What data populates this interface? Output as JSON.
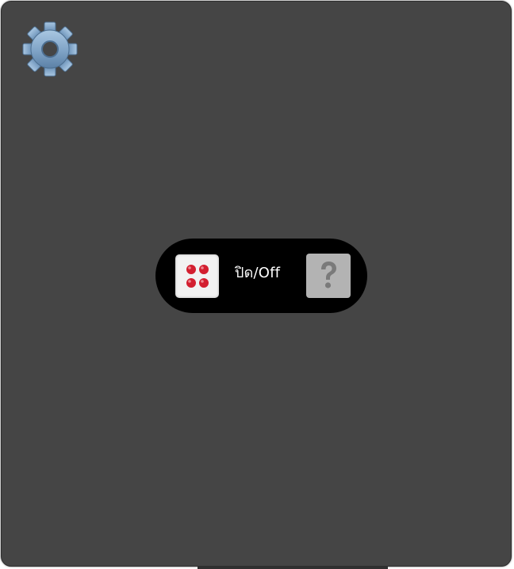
{
  "toolbar": {
    "settings_icon": "gear-icon",
    "dice_icon": "dice-four-icon",
    "mode_label": "ปิด/Off",
    "help_icon": "question-mark-icon"
  },
  "colors": {
    "panel_background": "#454545",
    "bar_background": "#000000",
    "gear": "#7ea2c4",
    "dice_face": "#f2f2f2",
    "dice_pips": "#d31f30",
    "help_button": "#b3b3b3",
    "help_glyph": "#7a7a7a"
  }
}
